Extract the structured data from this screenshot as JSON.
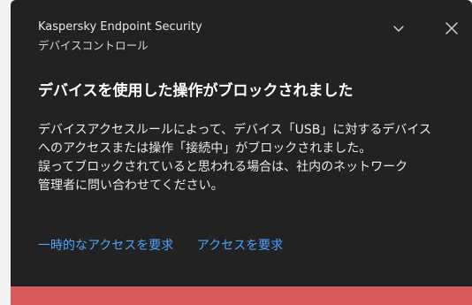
{
  "window": {
    "app_title": "Kaspersky Endpoint Security",
    "subtitle": "デバイスコントロール",
    "chevron_icon": "chevron-down-icon",
    "close_icon": "close-icon"
  },
  "notification": {
    "headline": "デバイスを使用した操作がブロックされました",
    "body_lines": [
      "デバイスアクセスルールによって、デバイス「USB」に対するデバイス",
      "へのアクセスまたは操作「接続中」がブロックされました。",
      "誤ってブロックされていると思われる場合は、社内のネットワーク",
      "管理者に問い合わせてください。"
    ],
    "actions": {
      "temp_access_label": "一時的なアクセスを要求",
      "access_label": "アクセスを要求"
    }
  },
  "colors": {
    "background": "#222222",
    "link": "#4da3ff",
    "status_bar": "#d85a5a"
  }
}
